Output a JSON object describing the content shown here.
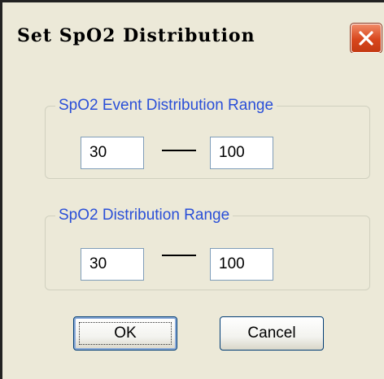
{
  "window": {
    "title": "Set SpO2 Distribution",
    "close_icon": "close-icon",
    "accent_close": "#d8461c"
  },
  "event_range": {
    "label": "SpO2 Event Distribution Range",
    "min_value": "30",
    "max_value": "100"
  },
  "distribution_range": {
    "label": "SpO2 Distribution Range",
    "min_value": "30",
    "max_value": "100"
  },
  "buttons": {
    "ok_label": "OK",
    "cancel_label": "Cancel"
  },
  "colors": {
    "dialog_background": "#ece9d8",
    "group_label": "#2a4fd8"
  }
}
